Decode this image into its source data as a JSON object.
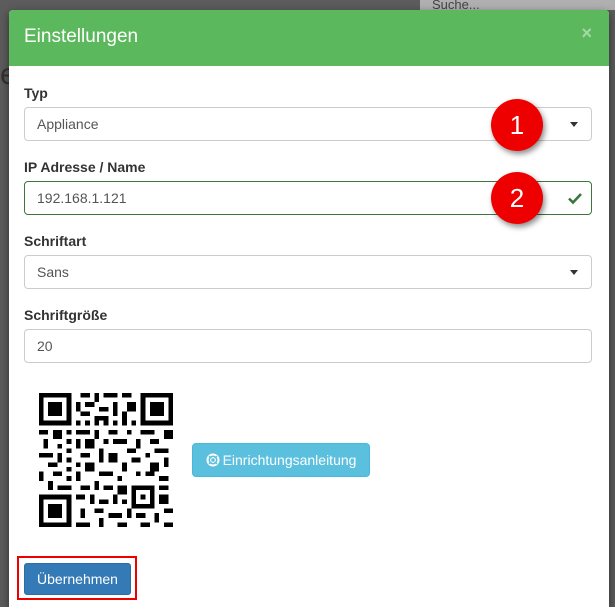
{
  "background": {
    "search_placeholder": "Suche...",
    "big_letter": "e"
  },
  "modal": {
    "title": "Einstellungen",
    "close_glyph": "×",
    "fields": {
      "typ": {
        "label": "Typ",
        "value": "Appliance"
      },
      "ip": {
        "label": "IP Adresse / Name",
        "value": "192.168.1.121"
      },
      "schriftart": {
        "label": "Schriftart",
        "value": "Sans"
      },
      "schriftgroesse": {
        "label": "Schriftgröße",
        "value": "20"
      }
    },
    "setup_button": {
      "label": "Einrichtungsanleitung",
      "icon": "lifebuoy-icon"
    },
    "apply_button": {
      "label": "Übernehmen"
    }
  },
  "annotations": {
    "badge_1": "1",
    "badge_2": "2"
  },
  "colors": {
    "header": "#5cb85c",
    "badge": "#e00000",
    "info_button": "#5bc0de",
    "primary_button": "#337ab7",
    "valid_border": "#3c763d"
  }
}
